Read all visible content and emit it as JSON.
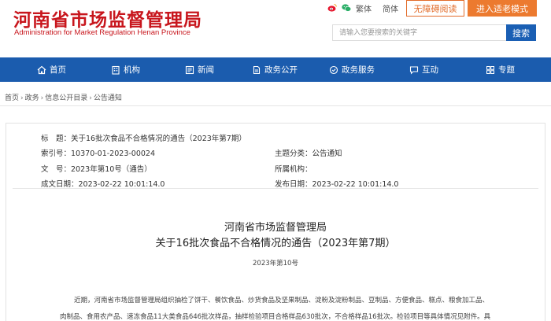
{
  "header": {
    "logo_cn": "河南省市场监督管理局",
    "logo_en": "Administration for Market Regulation Henan Province",
    "top_links": [
      {
        "label": "繁体",
        "icon": "weibo-icon"
      },
      {
        "label": "简体",
        "icon": "wechat-icon"
      }
    ],
    "weibo_icon": "weibo-icon",
    "wechat_icon": "wechat-icon",
    "accessible_label": "无障碍阅读",
    "elder_mode_label": "进入适老模式",
    "search_placeholder": "请输入您要搜索的关键字",
    "search_button": "搜索"
  },
  "nav": {
    "items": [
      {
        "label": "首页",
        "icon": "home-icon"
      },
      {
        "label": "机构",
        "icon": "building-icon"
      },
      {
        "label": "新闻",
        "icon": "news-icon"
      },
      {
        "label": "政务公开",
        "icon": "document-icon"
      },
      {
        "label": "政务服务",
        "icon": "service-icon"
      },
      {
        "label": "互动",
        "icon": "chat-icon"
      },
      {
        "label": "专题",
        "icon": "grid-icon"
      }
    ]
  },
  "breadcrumb": [
    "首页",
    "政务",
    "信息公开目录",
    "公告通知"
  ],
  "breadcrumb_sep": "›",
  "meta": {
    "title_label": "标　题：",
    "title_value": "关于16批次食品不合格情况的通告（2023年第7期）",
    "index_label": "索引号：",
    "index_value": "10370-01-2023-00024",
    "subject_label": "主题分类：",
    "subject_value": "公告通知",
    "docno_label": "文　号：",
    "docno_value": "2023年第10号（通告）",
    "org_label": "所属机构：",
    "org_value": "",
    "created_label": "成文日期：",
    "created_value": "2023-02-22 10:01:14.0",
    "published_label": "发布日期：",
    "published_value": "2023-02-22 10:01:14.0"
  },
  "article": {
    "title_line1": "河南省市场监督管理局",
    "title_line2": "关于16批次食品不合格情况的通告（2023年第7期）",
    "doc_number": "2023年第10号",
    "paragraph_line1": "近期，河南省市场监督管理局组织抽检了饼干、餐饮食品、炒货食品及坚果制品、淀粉及淀粉制品、豆制品、方便食品、糕点、粮食加工品、",
    "paragraph_line2": "肉制品、食用农产品、速冻食品11大类食品646批次样品，抽样检验项目合格样品630批次，不合格样品16批次。检验项目等具体情况见附件。具"
  },
  "colors": {
    "brand_red": "#c8161d",
    "nav_blue": "#1b5cae",
    "accent_orange": "#ec7a2f"
  }
}
